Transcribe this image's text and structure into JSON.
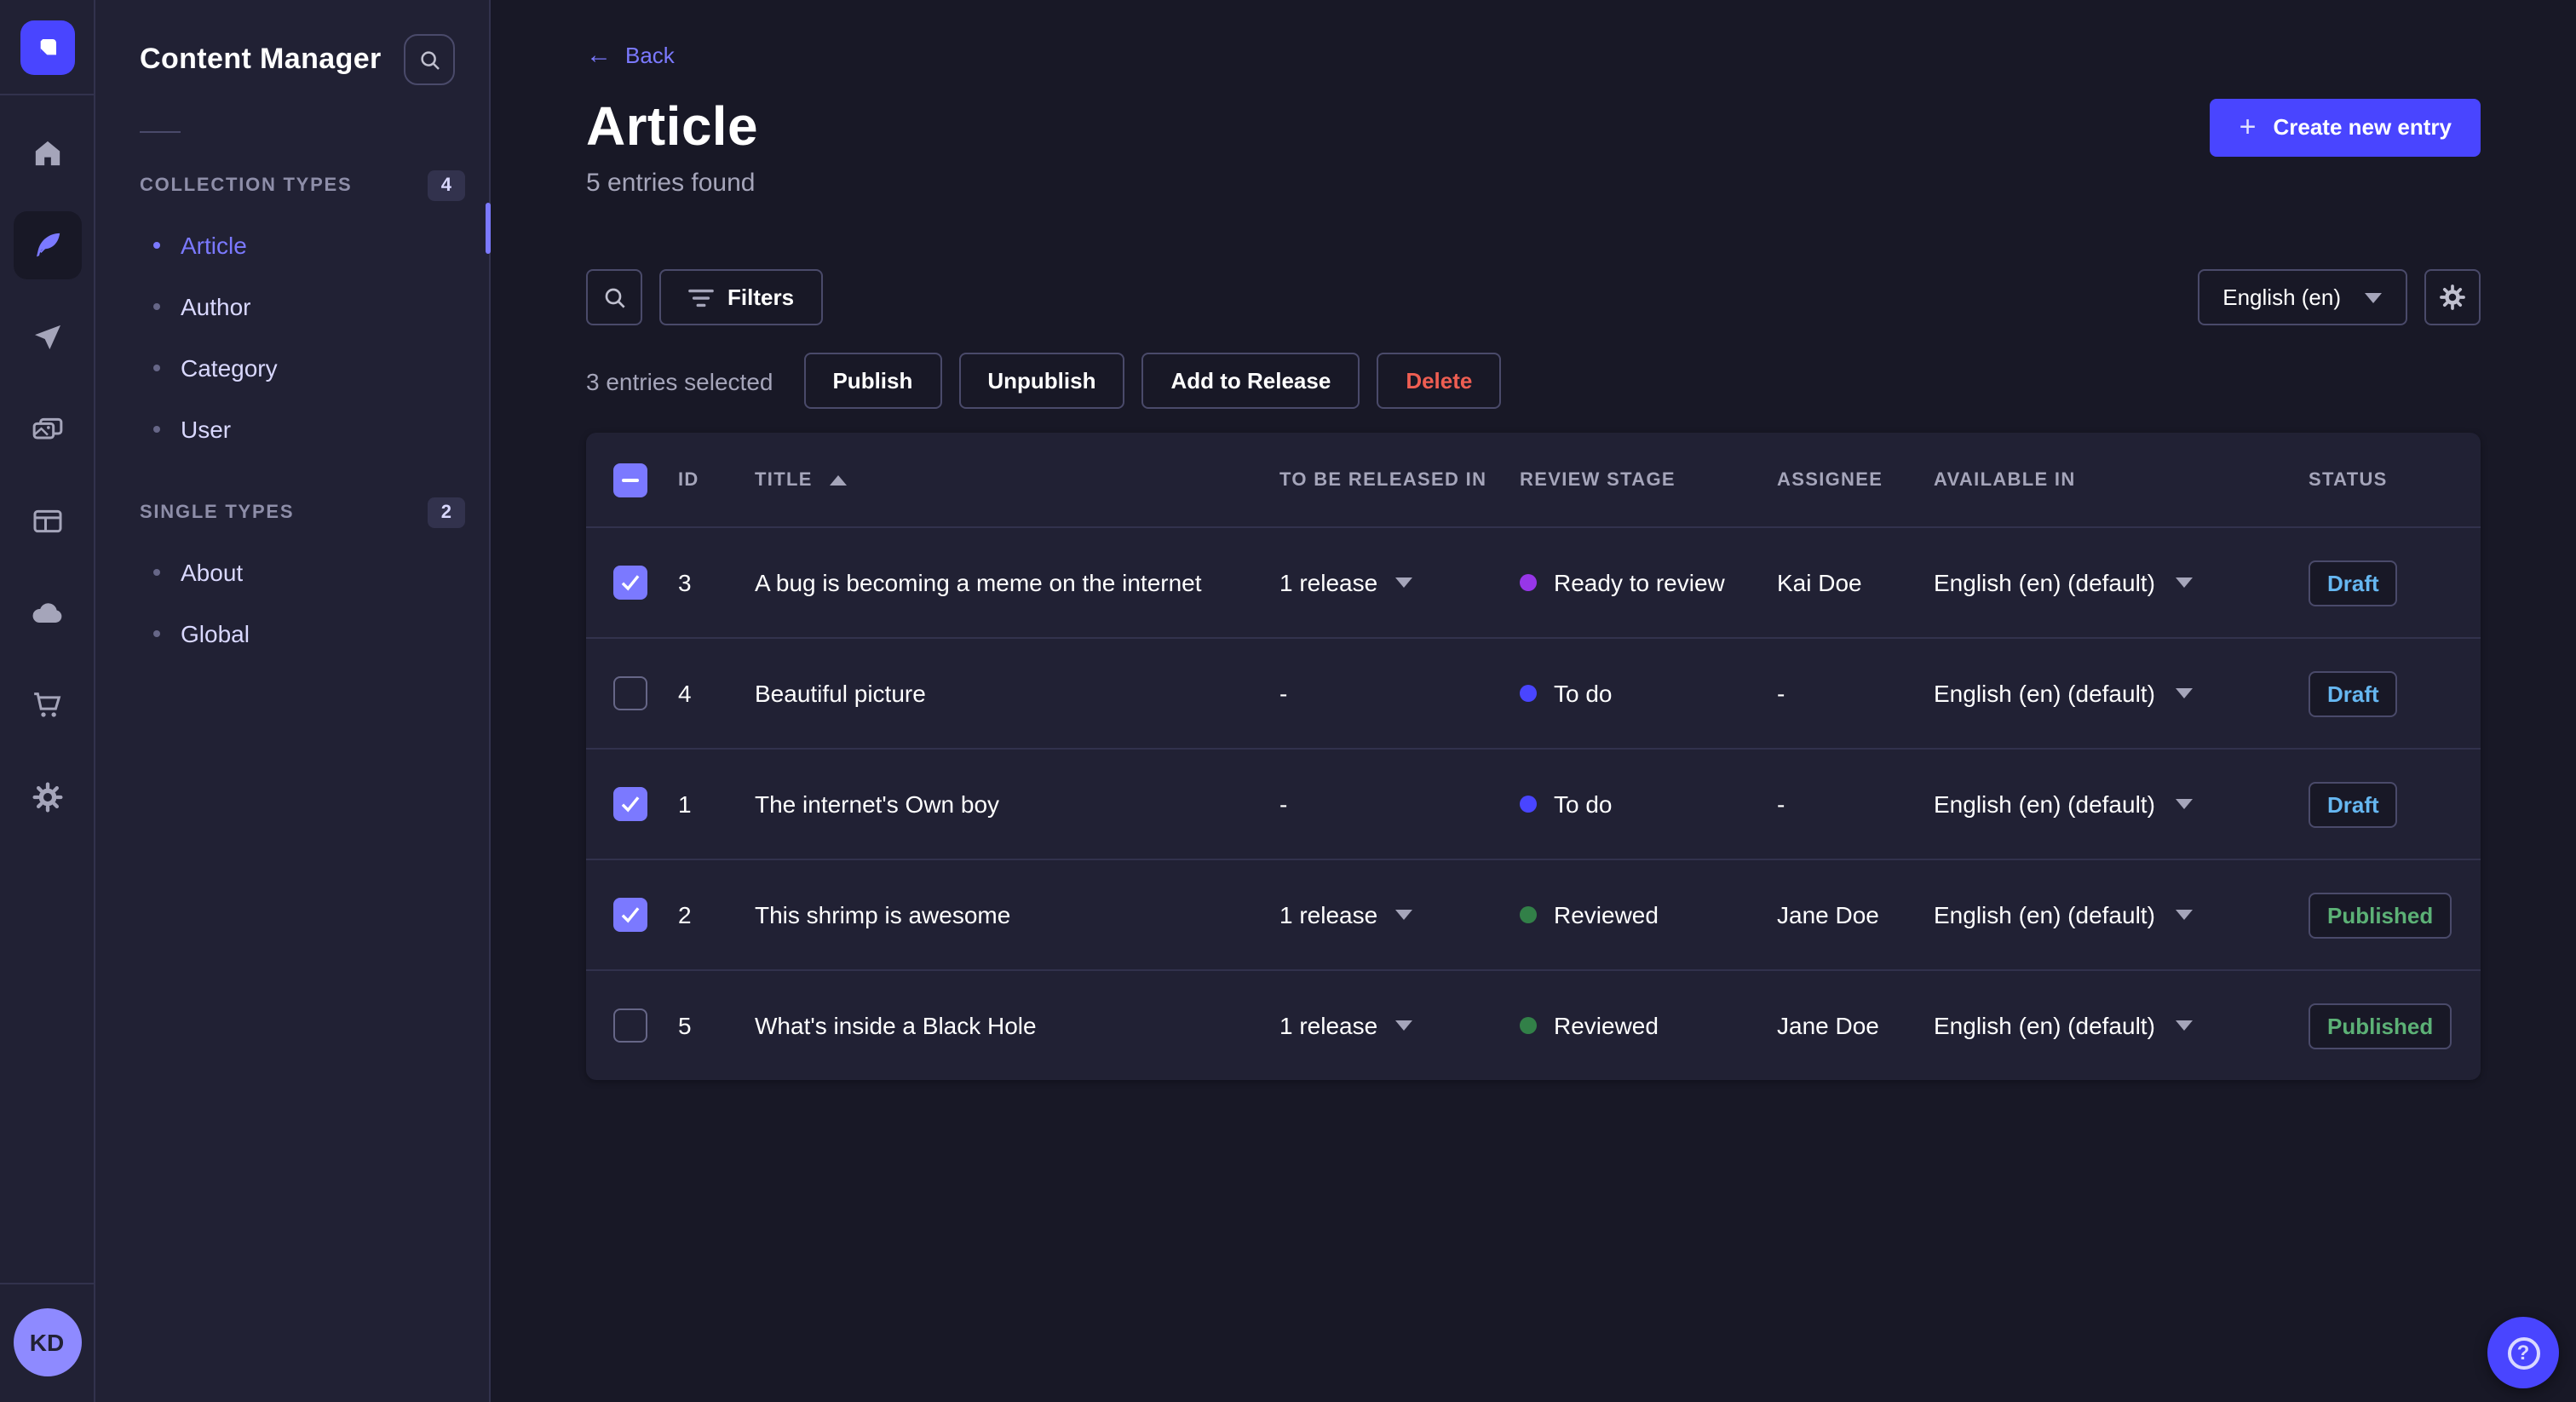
{
  "colors": {
    "accent": "#4945ff",
    "link": "#7b79ff",
    "draft": "#66b7f1",
    "published": "#5cb176",
    "danger": "#ee5e52",
    "stage_todo": "#4945ff",
    "stage_ready": "#9736e8",
    "stage_reviewed": "#328048"
  },
  "nav_rail": {
    "icons": [
      "home",
      "content-manager",
      "releases",
      "media-library",
      "content-type-builder",
      "deploy",
      "marketplace",
      "settings"
    ]
  },
  "user": {
    "initials": "KD"
  },
  "sidebar": {
    "title": "Content Manager",
    "sections": [
      {
        "label": "COLLECTION TYPES",
        "count": "4",
        "items": [
          {
            "label": "Article",
            "active": true
          },
          {
            "label": "Author",
            "active": false
          },
          {
            "label": "Category",
            "active": false
          },
          {
            "label": "User",
            "active": false
          }
        ]
      },
      {
        "label": "SINGLE TYPES",
        "count": "2",
        "items": [
          {
            "label": "About",
            "active": false
          },
          {
            "label": "Global",
            "active": false
          }
        ]
      }
    ]
  },
  "header": {
    "back_label": "Back",
    "title": "Article",
    "subtitle": "5 entries found",
    "create_button": "Create new entry"
  },
  "toolbar": {
    "filters_label": "Filters",
    "locale": "English (en)"
  },
  "bulk_bar": {
    "selected_text": "3 entries selected",
    "publish": "Publish",
    "unpublish": "Unpublish",
    "add_to_release": "Add to Release",
    "delete": "Delete"
  },
  "table": {
    "columns": [
      "ID",
      "TITLE",
      "TO BE RELEASED IN",
      "REVIEW STAGE",
      "ASSIGNEE",
      "AVAILABLE IN",
      "STATUS"
    ],
    "rows": [
      {
        "selected": true,
        "id": "3",
        "title": "A bug is becoming a meme on the internet",
        "release": "1 release",
        "has_release": true,
        "review_stage": "Ready to review",
        "stage_color": "#9736e8",
        "assignee": "Kai Doe",
        "available": "English (en) (default)",
        "status": "Draft",
        "status_color": "#66b7f1"
      },
      {
        "selected": false,
        "id": "4",
        "title": "Beautiful picture",
        "release": "-",
        "has_release": false,
        "review_stage": "To do",
        "stage_color": "#4945ff",
        "assignee": "-",
        "available": "English (en) (default)",
        "status": "Draft",
        "status_color": "#66b7f1"
      },
      {
        "selected": true,
        "id": "1",
        "title": "The internet's Own boy",
        "release": "-",
        "has_release": false,
        "review_stage": "To do",
        "stage_color": "#4945ff",
        "assignee": "-",
        "available": "English (en) (default)",
        "status": "Draft",
        "status_color": "#66b7f1"
      },
      {
        "selected": true,
        "id": "2",
        "title": "This shrimp is awesome",
        "release": "1 release",
        "has_release": true,
        "review_stage": "Reviewed",
        "stage_color": "#328048",
        "assignee": "Jane Doe",
        "available": "English (en) (default)",
        "status": "Published",
        "status_color": "#5cb176"
      },
      {
        "selected": false,
        "id": "5",
        "title": "What's inside a Black Hole",
        "release": "1 release",
        "has_release": true,
        "review_stage": "Reviewed",
        "stage_color": "#328048",
        "assignee": "Jane Doe",
        "available": "English (en) (default)",
        "status": "Published",
        "status_color": "#5cb176"
      }
    ]
  }
}
